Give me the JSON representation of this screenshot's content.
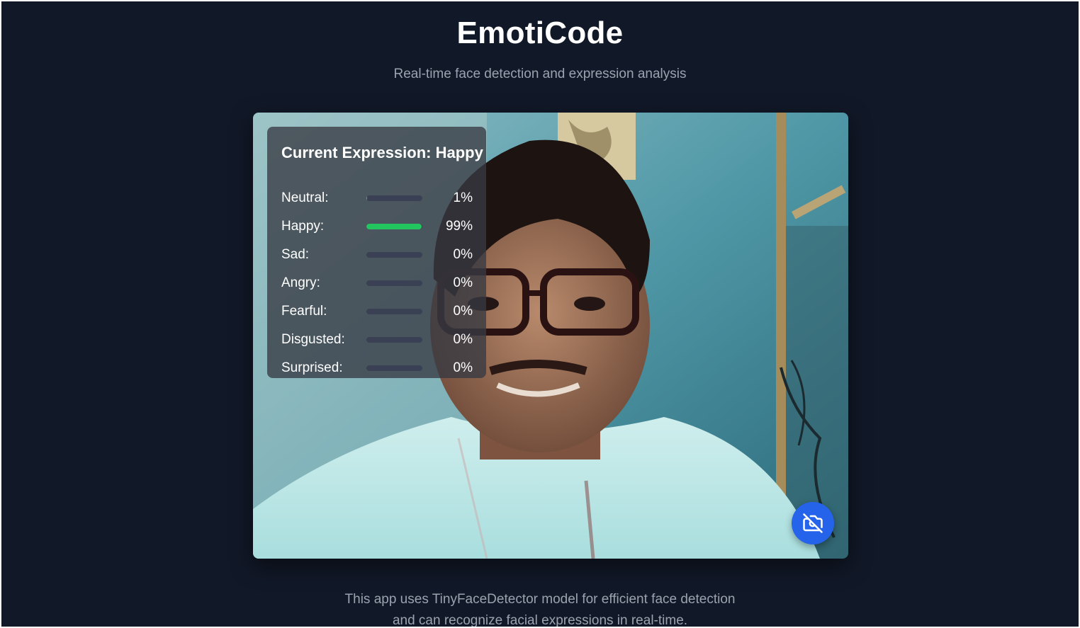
{
  "header": {
    "title": "EmotiCode",
    "subtitle": "Real-time face detection and expression analysis"
  },
  "expression_panel": {
    "title": "Current Expression: Happy",
    "items": [
      {
        "label": "Neutral:",
        "percent_text": "1%",
        "value": 0.01
      },
      {
        "label": "Happy:",
        "percent_text": "99%",
        "value": 0.99
      },
      {
        "label": "Sad:",
        "percent_text": "0%",
        "value": 0
      },
      {
        "label": "Angry:",
        "percent_text": "0%",
        "value": 0
      },
      {
        "label": "Fearful:",
        "percent_text": "0%",
        "value": 0
      },
      {
        "label": "Disgusted:",
        "percent_text": "0%",
        "value": 0
      },
      {
        "label": "Surprised:",
        "percent_text": "0%",
        "value": 0
      }
    ]
  },
  "camera_button": {
    "icon": "camera-off-icon"
  },
  "footer": {
    "line1": "This app uses TinyFaceDetector model for efficient face detection",
    "line2": "and can recognize facial expressions in real-time."
  },
  "colors": {
    "background": "#111827",
    "accent": "#2563eb",
    "bar_fill": "#22c55e",
    "bar_track": "#3a4155"
  }
}
